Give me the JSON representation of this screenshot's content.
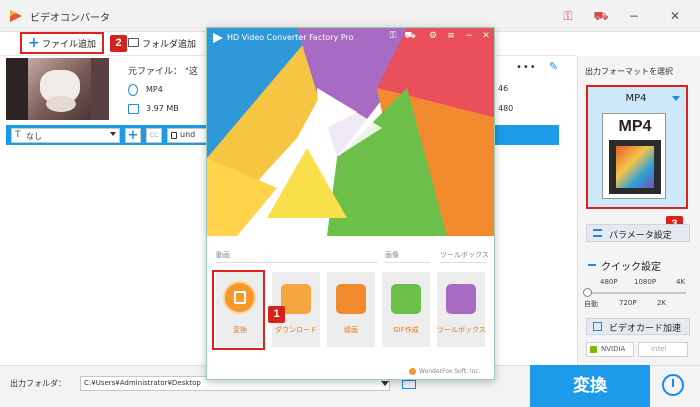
{
  "window": {
    "title": "ビデオコンバータ",
    "controls": {
      "minimize": "−",
      "close": "✕"
    }
  },
  "toolbar": {
    "add_file_label": "ファイル追加",
    "add_folder_label": "フォルダ追加"
  },
  "badges": {
    "one": "1",
    "two": "2",
    "three": "3"
  },
  "file_item": {
    "source_label": "元ファイル： \"这",
    "format": "MP4",
    "size": "3.97 MB",
    "menu_dots": "•••",
    "right_value_1": "46",
    "right_value_2": "480"
  },
  "file_bar": {
    "subtitle_icon": "T",
    "subtitle_value": "なし",
    "add_label": "+",
    "cc_label": "CC",
    "audio_value": "und"
  },
  "right_panel": {
    "output_format_label": "出力フォーマットを選択",
    "selected_format": "MP4",
    "format_icon_text": "MP4",
    "param_button_label": "パラメータ設定",
    "quick_setting_label": "クイック設定",
    "quality_top": [
      "480P",
      "1080P",
      "4K"
    ],
    "quality_bottom": [
      "自動",
      "720P",
      "2K"
    ],
    "gpu_button_label": "ビデオカード加速",
    "nvidia_label": "NVIDIA",
    "intel_label": "intel"
  },
  "bottom_bar": {
    "output_folder_label": "出力フォルダ：",
    "output_folder_path": "C:¥Users¥Administrator¥Desktop",
    "convert_button_label": "変換"
  },
  "popup": {
    "title": "HD Video Converter Factory Pro",
    "sections": {
      "video": "動画",
      "image": "画像",
      "toolbox": "ツールボックス"
    },
    "tiles": [
      {
        "label": "変換",
        "icon": "film-icon"
      },
      {
        "label": "ダウンロード",
        "icon": "download-icon"
      },
      {
        "label": "録画",
        "icon": "record-icon"
      },
      {
        "label": "GIF作成",
        "icon": "gif-icon"
      },
      {
        "label": "ツールボックス",
        "icon": "toolbox-icon"
      }
    ],
    "brand": "WonderFox Soft, Inc."
  },
  "colors": {
    "accent_blue": "#1e9aea",
    "highlight_red": "#e0201c",
    "tile_orange": "#e07b1b"
  }
}
